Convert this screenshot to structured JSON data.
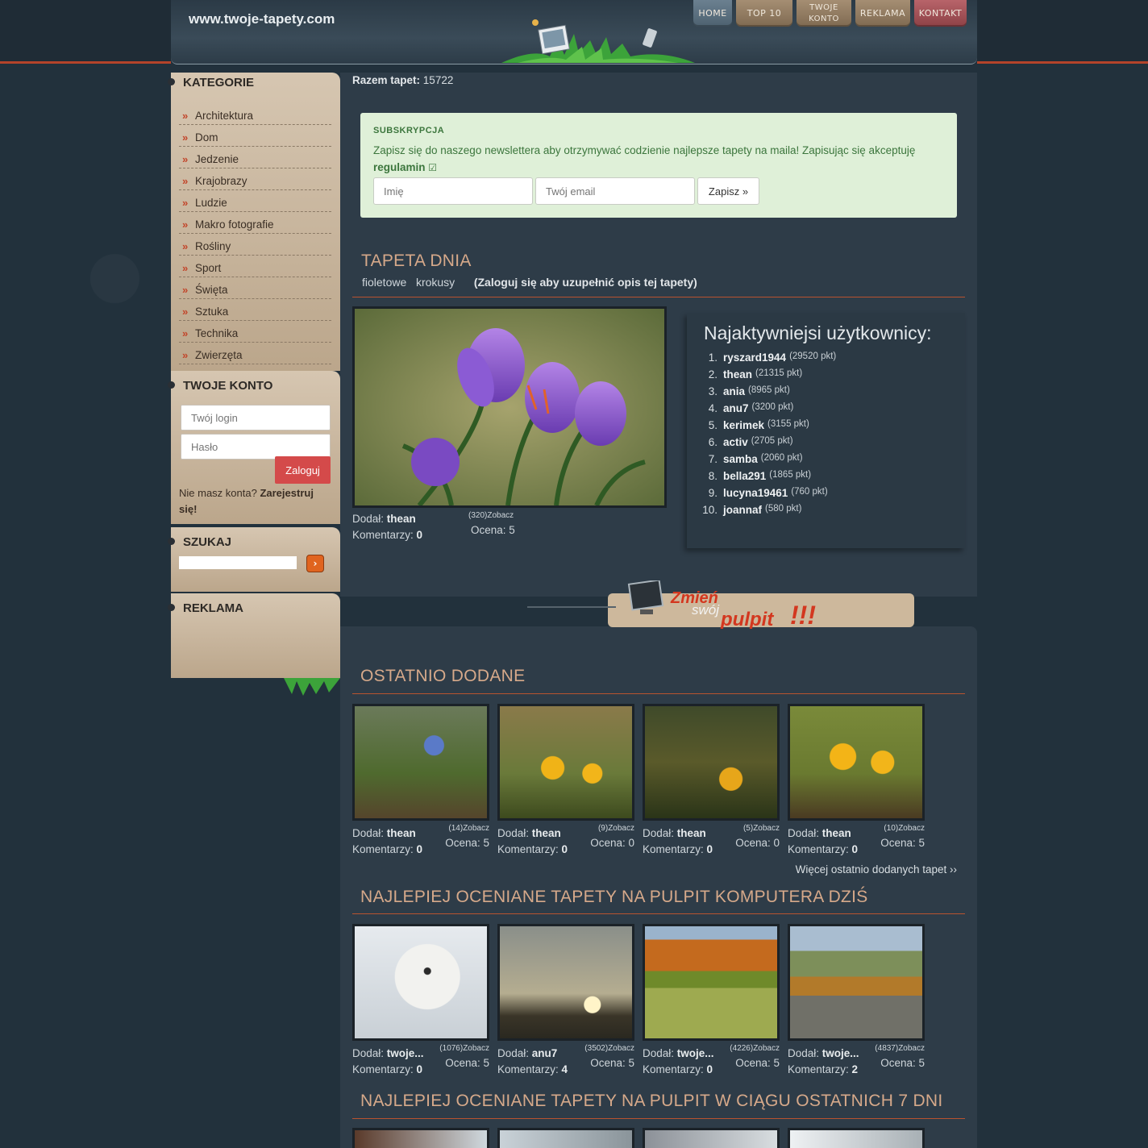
{
  "header": {
    "site_url": "www.twoje-tapety.com",
    "nav": [
      {
        "label": "HOME"
      },
      {
        "label": "TOP 10"
      },
      {
        "label": "TWOJE KONTO"
      },
      {
        "label": "REKLAMA"
      },
      {
        "label": "KONTAKT"
      }
    ]
  },
  "sidebar": {
    "kategorie_title": "KATEGORIE",
    "categories": [
      "Architektura",
      "Dom",
      "Jedzenie",
      "Krajobrazy",
      "Ludzie",
      "Makro fotografie",
      "Rośliny",
      "Sport",
      "Święta",
      "Sztuka",
      "Technika",
      "Zwierzęta"
    ],
    "arrow": "»",
    "konto_title": "TWOJE KONTO",
    "login_placeholder": "Twój login",
    "password_placeholder": "Hasło",
    "login_button": "Zaloguj",
    "register_text": "Nie masz konta?",
    "register_link": "Zarejestruj się!",
    "szukaj_title": "SZUKAJ",
    "search_button": "›",
    "reklama_title": "REKLAMA"
  },
  "main": {
    "total_label": "Razem tapet:",
    "total_value": "15722",
    "newsletter": {
      "title": "SUBSKRYPCJA",
      "text": "Zapisz się do naszego newslettera aby otrzymywać codzienie najlepsze tapety na maila! Zapisując się akceptuję",
      "terms_link": "regulamin",
      "name_placeholder": "Imię",
      "email_placeholder": "Twój email",
      "button": "Zapisz »"
    },
    "tapeta_dnia": {
      "title": "TAPETA DNIA",
      "tag1": "fioletowe",
      "tag2": "krokusy",
      "login_note": "(Zaloguj się aby uzupełnić opis tej tapety)",
      "added_label": "Dodał:",
      "author": "thean",
      "comments_label": "Komentarzy:",
      "comments": "0",
      "views": "(320)",
      "view_link": "Zobacz",
      "rating_label": "Ocena:",
      "rating": "5"
    },
    "active_users": {
      "title": "Najaktywniejsi użytkownicy:",
      "users": [
        {
          "num": "1.",
          "name": "ryszard1944",
          "pts": "(29520 pkt)"
        },
        {
          "num": "2.",
          "name": "thean",
          "pts": "(21315 pkt)"
        },
        {
          "num": "3.",
          "name": "ania",
          "pts": "(8965 pkt)"
        },
        {
          "num": "4.",
          "name": "anu7",
          "pts": "(3200 pkt)"
        },
        {
          "num": "5.",
          "name": "kerimek",
          "pts": "(3155 pkt)"
        },
        {
          "num": "6.",
          "name": "activ",
          "pts": "(2705 pkt)"
        },
        {
          "num": "7.",
          "name": "samba",
          "pts": "(2060 pkt)"
        },
        {
          "num": "8.",
          "name": "bella291",
          "pts": "(1865 pkt)"
        },
        {
          "num": "9.",
          "name": "lucyna19461",
          "pts": "(760 pkt)"
        },
        {
          "num": "10.",
          "name": "joannaf",
          "pts": "(580 pkt)"
        }
      ]
    },
    "banner": {
      "line1": "Zmień",
      "line2": "swój",
      "line3": "pulpit",
      "exclaim": "!!!"
    },
    "ostatnio": {
      "title": "OSTATNIO DODANE",
      "items": [
        {
          "author": "thean",
          "comments": "0",
          "views": "(14)",
          "rating": "5"
        },
        {
          "author": "thean",
          "comments": "0",
          "views": "(9)",
          "rating": "0"
        },
        {
          "author": "thean",
          "comments": "0",
          "views": "(5)",
          "rating": "0"
        },
        {
          "author": "thean",
          "comments": "0",
          "views": "(10)",
          "rating": "5"
        }
      ],
      "more": "Więcej ostatnio dodanych tapet ››"
    },
    "najlepsze_dzis": {
      "title": "NAJLEPIEJ OCENIANE TAPETY NA PULPIT KOMPUTERA DZIŚ",
      "items": [
        {
          "author": "twoje...",
          "comments": "0",
          "views": "(1076)",
          "rating": "5"
        },
        {
          "author": "anu7",
          "comments": "4",
          "views": "(3502)",
          "rating": "5"
        },
        {
          "author": "twoje...",
          "comments": "0",
          "views": "(4226)",
          "rating": "5"
        },
        {
          "author": "twoje...",
          "comments": "2",
          "views": "(4837)",
          "rating": "5"
        }
      ]
    },
    "najlepsze_7dni": {
      "title": "NAJLEPIEJ OCENIANE TAPETY NA PULPIT W CIĄGU OSTATNICH 7 DNI"
    },
    "labels": {
      "added": "Dodał:",
      "comments": "Komentarzy:",
      "view": "Zobacz",
      "rating": "Ocena:"
    }
  }
}
